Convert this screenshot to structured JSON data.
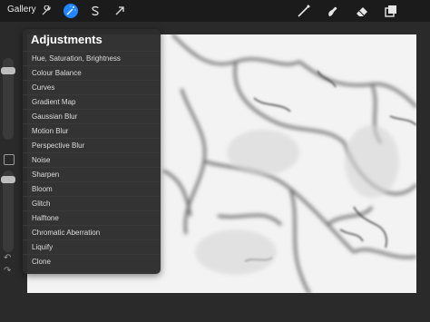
{
  "topbar": {
    "gallery_label": "Gallery",
    "left_tools": [
      "wrench-icon",
      "magic-wand-icon",
      "selection-s-icon",
      "transform-arrow-icon"
    ],
    "active_tool": "magic-wand-icon",
    "right_tools": [
      "brush-icon",
      "smudge-icon",
      "eraser-icon",
      "layers-icon"
    ],
    "accent_color": "#1f86ff"
  },
  "adjustments": {
    "title": "Adjustments",
    "items": [
      "Hue, Saturation, Brightness",
      "Colour Balance",
      "Curves",
      "Gradient Map",
      "Gaussian Blur",
      "Motion Blur",
      "Perspective Blur",
      "Noise",
      "Sharpen",
      "Bloom",
      "Glitch",
      "Halftone",
      "Chromatic Aberration",
      "Liquify",
      "Clone"
    ]
  },
  "sidebar": {
    "tools": [
      "brush-size-slider",
      "modify-button",
      "opacity-slider",
      "undo-icon",
      "redo-icon"
    ]
  }
}
